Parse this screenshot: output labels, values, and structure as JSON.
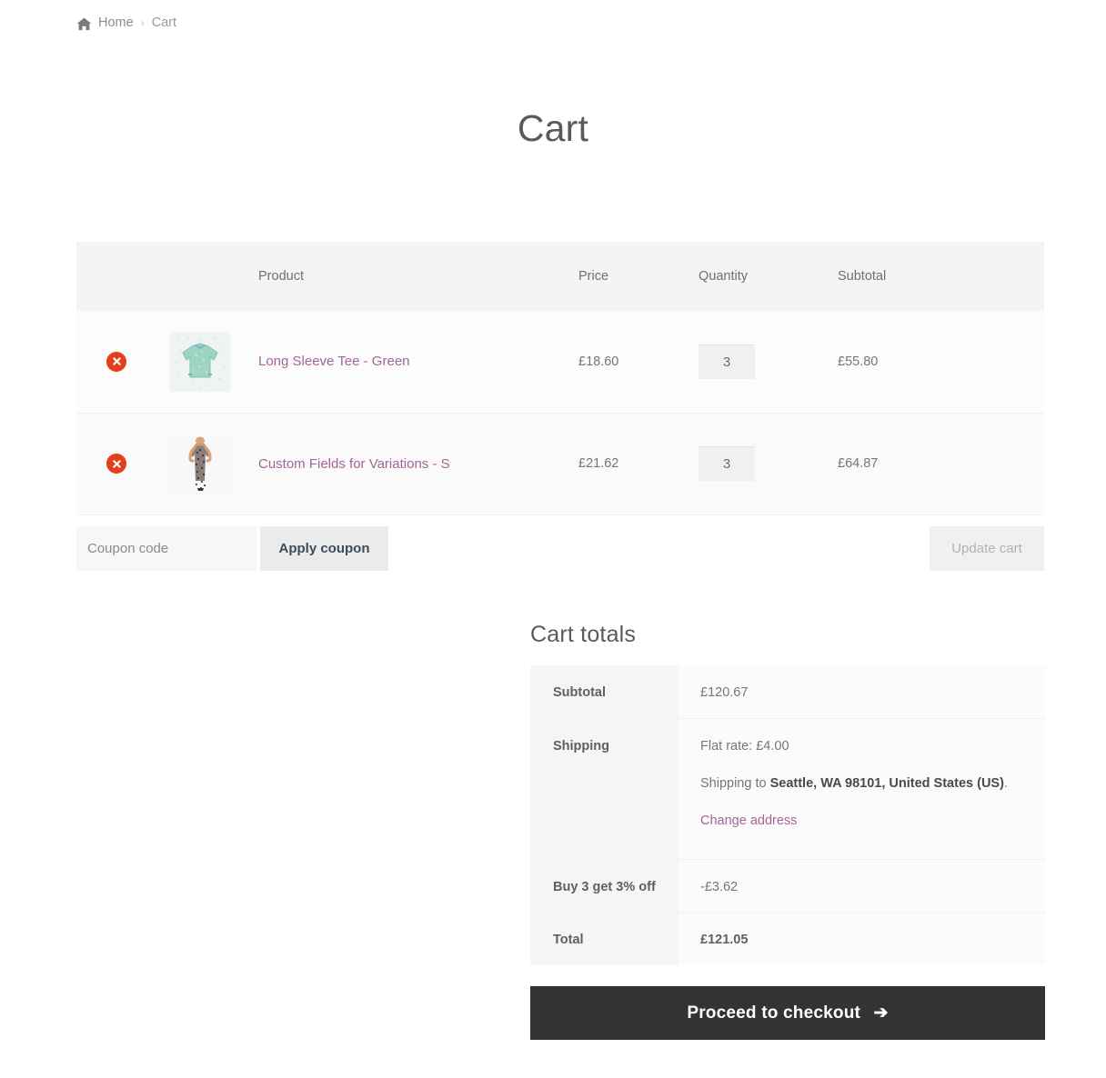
{
  "breadcrumb": {
    "home_icon": "home-icon",
    "home_label": "Home",
    "separator": "›",
    "current": "Cart"
  },
  "page": {
    "title": "Cart"
  },
  "cart_table": {
    "headers": {
      "remove": "",
      "thumbnail": "",
      "product": "Product",
      "price": "Price",
      "quantity": "Quantity",
      "subtotal": "Subtotal"
    },
    "remove_icon": "remove-x-icon",
    "rows": [
      {
        "remove_label": "×",
        "thumb_icon": "long-sleeve-tee-thumbnail",
        "name": "Long Sleeve Tee - Green",
        "price": "£18.60",
        "quantity": "3",
        "subtotal": "£55.80"
      },
      {
        "remove_label": "×",
        "thumb_icon": "dress-thumbnail",
        "name": "Custom Fields for Variations - S",
        "price": "£21.62",
        "quantity": "3",
        "subtotal": "£64.87"
      }
    ]
  },
  "coupon": {
    "placeholder": "Coupon code",
    "value": "",
    "apply_label": "Apply coupon",
    "update_cart_label": "Update cart"
  },
  "totals": {
    "title": "Cart totals",
    "subtotal_label": "Subtotal",
    "subtotal_value": "£120.67",
    "shipping_label": "Shipping",
    "shipping_rate": "Flat rate: £4.00",
    "shipping_to_prefix": "Shipping to ",
    "shipping_to_address": "Seattle, WA 98101, United States (US)",
    "shipping_to_suffix": ".",
    "change_address_label": "Change address",
    "discount_label": "Buy 3 get 3% off",
    "discount_value": "-£3.62",
    "total_label": "Total",
    "total_value": "£121.05"
  },
  "checkout": {
    "label": "Proceed to checkout",
    "arrow": "➔"
  },
  "colors": {
    "accent_link": "#a46497",
    "remove_red": "#e2401c",
    "checkout_bg": "#333333",
    "header_bg": "#f4f4f4"
  }
}
